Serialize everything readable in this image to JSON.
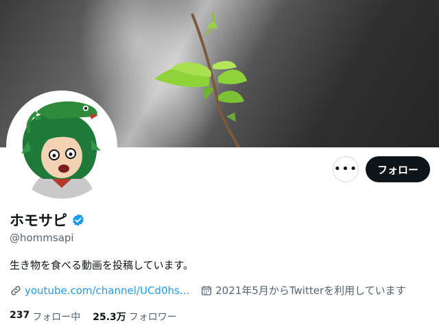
{
  "profile": {
    "display_name": "ホモサピ",
    "handle": "@hommsapi",
    "bio": "生き物を食べる動画を投稿しています。",
    "link_text": "youtube.com/channel/UCd0hs...",
    "joined_text": "2021年5月からTwitterを利用しています",
    "verified_color": "#1d9bf0"
  },
  "actions": {
    "more_label": "•••",
    "follow_label": "フォロー"
  },
  "stats": {
    "following_count": "237",
    "following_label": "フォロー中",
    "followers_count": "25.3万",
    "followers_label": "フォロワー"
  },
  "icons": [
    "link-icon",
    "calendar-icon",
    "verified-badge-icon",
    "more-icon"
  ]
}
